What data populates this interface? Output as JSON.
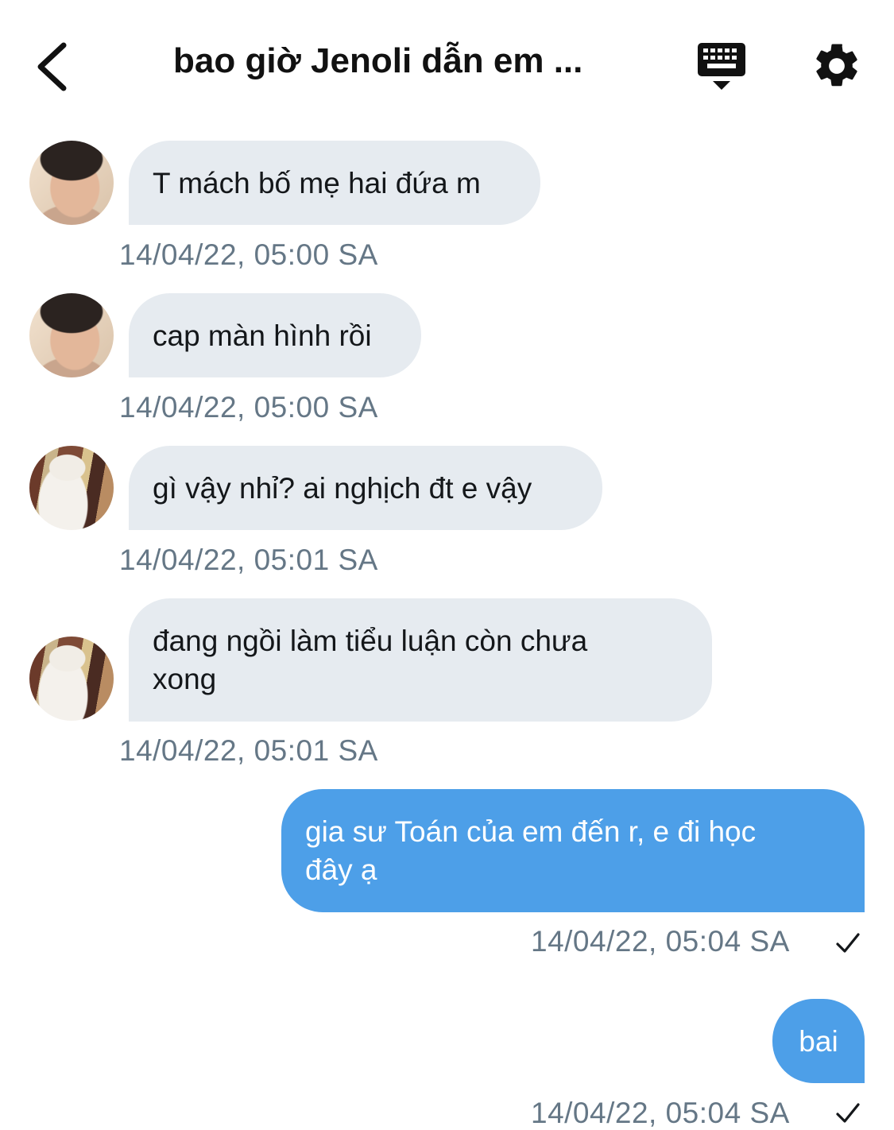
{
  "header": {
    "title": "bao giờ Jenoli dẫn em ..."
  },
  "messages": [
    {
      "text": "T mách bố mẹ hai đứa m",
      "time": "14/04/22, 05:00 SA"
    },
    {
      "text": "cap màn hình rồi",
      "time": "14/04/22, 05:00 SA"
    },
    {
      "text": "gì vậy nhỉ? ai nghịch đt e vậy",
      "time": "14/04/22, 05:01 SA"
    },
    {
      "text": "đang ngồi làm tiểu luận còn chưa\nxong",
      "time": "14/04/22, 05:01 SA"
    },
    {
      "text": "gia sư Toán của em đến r, e đi học\nđây ạ",
      "time": "14/04/22, 05:04 SA"
    },
    {
      "text": "bai",
      "time": "14/04/22, 05:04 SA"
    }
  ],
  "colors": {
    "incoming_bubble": "#e6ebf0",
    "outgoing_bubble": "#4d9fe8",
    "timestamp": "#657786"
  },
  "icons": {
    "back": "back-chevron-icon",
    "keyboard": "keyboard-icon",
    "settings": "gear-icon",
    "read": "checkmark-icon"
  }
}
